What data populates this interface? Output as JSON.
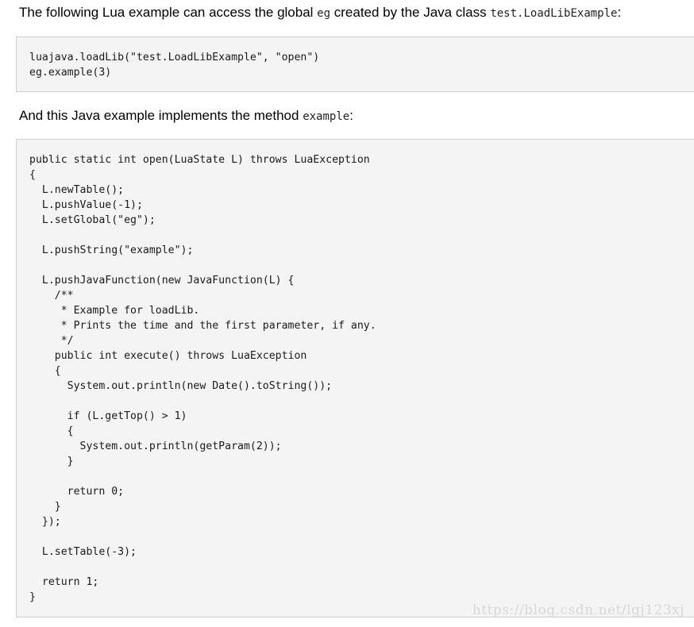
{
  "intro1": {
    "text_before": "The following Lua example can access the global ",
    "code_eg": "eg",
    "text_mid": " created by the Java class ",
    "code_class": "test.LoadLibExample",
    "text_after": ":"
  },
  "code1": "luajava.loadLib(\"test.LoadLibExample\", \"open\")\neg.example(3)",
  "intro2": {
    "text_before": "And this Java example implements the method ",
    "code_method": "example",
    "text_after": ":"
  },
  "code2": "public static int open(LuaState L) throws LuaException\n{\n  L.newTable();\n  L.pushValue(-1);\n  L.setGlobal(\"eg\");\n\n  L.pushString(\"example\");\n\n  L.pushJavaFunction(new JavaFunction(L) {\n    /**\n     * Example for loadLib.\n     * Prints the time and the first parameter, if any.\n     */\n    public int execute() throws LuaException\n    {\n      System.out.println(new Date().toString());\n\n      if (L.getTop() > 1)\n      {\n        System.out.println(getParam(2));\n      }\n\n      return 0;\n    }\n  });\n\n  L.setTable(-3);\n\n  return 1;\n}",
  "watermark": "https://blog.csdn.net/lgj123xj"
}
